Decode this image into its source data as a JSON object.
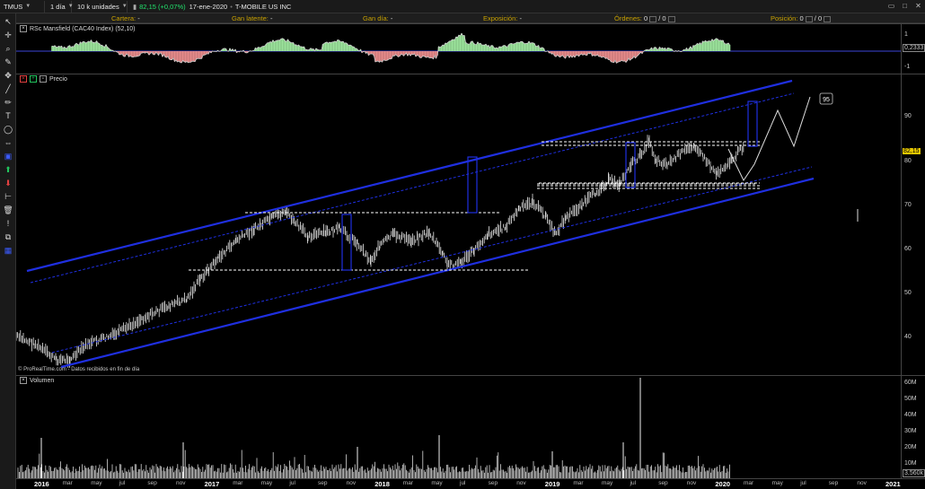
{
  "toolbar": {
    "symbol": "TMUS",
    "timeframe": "1 día",
    "units": "10 k unidades",
    "quote": "82,15 (+0,07%)",
    "date": "17-ene-2020",
    "name": "T-MOBILE US INC"
  },
  "portfolio": {
    "cartera_label": "Cartera:",
    "cartera_value": "-",
    "ganancia_label": "Gan latente:",
    "ganancia_value": "-",
    "gandia_label": "Gan día:",
    "gandia_value": "-",
    "exposicion_label": "Exposición:",
    "exposicion_value": "-",
    "ordenes_label": "Órdenes:",
    "ordenes_value": "0",
    "ordenes_value2": "0",
    "posicion_label": "Posición:",
    "posicion_value": "0",
    "posicion_value2": "0"
  },
  "indicator_panel": {
    "title": "RSc Mansfield (CAC40 Index) (52,10)",
    "current_value": "0,2333",
    "scale": [
      "1",
      "0",
      "-1"
    ]
  },
  "price_panel": {
    "title": "Precio",
    "watermark": "© ProRealTime.com - Datos recibidos en fin de día",
    "current_price": "82,15",
    "target_label": "95",
    "scale": [
      "90",
      "80",
      "70",
      "60",
      "50",
      "40"
    ]
  },
  "volume_panel": {
    "title": "Volumen",
    "current_value": "3,560k",
    "scale": [
      "60M",
      "50M",
      "40M",
      "30M",
      "20M",
      "10M"
    ]
  },
  "x_axis": [
    "2016",
    "mar",
    "may",
    "jul",
    "sep",
    "nov",
    "2017",
    "mar",
    "may",
    "jul",
    "sep",
    "nov",
    "2018",
    "mar",
    "may",
    "jul",
    "sep",
    "nov",
    "2019",
    "mar",
    "may",
    "jul",
    "sep",
    "nov",
    "2020",
    "mar",
    "may",
    "jul",
    "sep",
    "nov",
    "2021"
  ],
  "colors": {
    "channel": "#1f2fe0",
    "quote_up": "#22e36d",
    "rs_positive": "#9be39b",
    "rs_negative": "#e58a8a",
    "price_tag": "#e8c800"
  },
  "icons": [
    "cursor-icon",
    "crosshair-icon",
    "zoom-icon",
    "pencil-icon",
    "line-icon",
    "text-icon",
    "shape-icon",
    "move-icon",
    "arrow-up-icon",
    "arrow-down-icon",
    "ruler-icon",
    "trash-icon",
    "lock-icon",
    "copy-icon",
    "layers-icon"
  ]
}
